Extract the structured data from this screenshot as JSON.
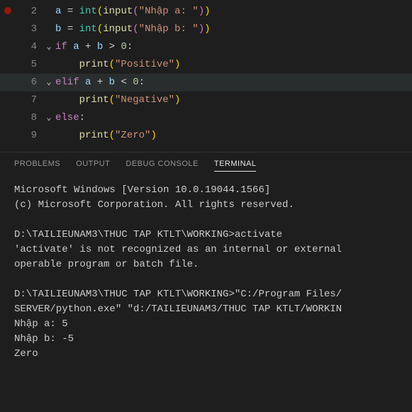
{
  "editor": {
    "lines": [
      {
        "num": "2",
        "fold": "",
        "highlight": false,
        "tokens": [
          {
            "t": "a",
            "c": "tok-var"
          },
          {
            "t": " ",
            "c": ""
          },
          {
            "t": "=",
            "c": "tok-op"
          },
          {
            "t": " ",
            "c": ""
          },
          {
            "t": "int",
            "c": "tok-builtin"
          },
          {
            "t": "(",
            "c": "tok-paren"
          },
          {
            "t": "input",
            "c": "tok-func"
          },
          {
            "t": "(",
            "c": "tok-paren2"
          },
          {
            "t": "\"Nhập a: \"",
            "c": "tok-str"
          },
          {
            "t": ")",
            "c": "tok-paren2"
          },
          {
            "t": ")",
            "c": "tok-paren"
          }
        ]
      },
      {
        "num": "3",
        "fold": "",
        "highlight": false,
        "tokens": [
          {
            "t": "b",
            "c": "tok-var"
          },
          {
            "t": " ",
            "c": ""
          },
          {
            "t": "=",
            "c": "tok-op"
          },
          {
            "t": " ",
            "c": ""
          },
          {
            "t": "int",
            "c": "tok-builtin"
          },
          {
            "t": "(",
            "c": "tok-paren"
          },
          {
            "t": "input",
            "c": "tok-func"
          },
          {
            "t": "(",
            "c": "tok-paren2"
          },
          {
            "t": "\"Nhập b: \"",
            "c": "tok-str"
          },
          {
            "t": ")",
            "c": "tok-paren2"
          },
          {
            "t": ")",
            "c": "tok-paren"
          }
        ]
      },
      {
        "num": "4",
        "fold": "⌄",
        "highlight": false,
        "tokens": [
          {
            "t": "if",
            "c": "tok-kw"
          },
          {
            "t": " ",
            "c": ""
          },
          {
            "t": "a",
            "c": "tok-var"
          },
          {
            "t": " ",
            "c": ""
          },
          {
            "t": "+",
            "c": "tok-op"
          },
          {
            "t": " ",
            "c": ""
          },
          {
            "t": "b",
            "c": "tok-var"
          },
          {
            "t": " ",
            "c": ""
          },
          {
            "t": ">",
            "c": "tok-op"
          },
          {
            "t": " ",
            "c": ""
          },
          {
            "t": "0",
            "c": "tok-num"
          },
          {
            "t": ":",
            "c": "tok-op"
          }
        ]
      },
      {
        "num": "5",
        "fold": "",
        "highlight": false,
        "indent": 1,
        "tokens": [
          {
            "t": "    ",
            "c": ""
          },
          {
            "t": "print",
            "c": "tok-func"
          },
          {
            "t": "(",
            "c": "tok-paren"
          },
          {
            "t": "\"Positive\"",
            "c": "tok-str"
          },
          {
            "t": ")",
            "c": "tok-paren"
          }
        ]
      },
      {
        "num": "6",
        "fold": "⌄",
        "highlight": true,
        "tokens": [
          {
            "t": "elif",
            "c": "tok-kw"
          },
          {
            "t": " ",
            "c": ""
          },
          {
            "t": "a",
            "c": "tok-var"
          },
          {
            "t": " ",
            "c": ""
          },
          {
            "t": "+",
            "c": "tok-op"
          },
          {
            "t": " ",
            "c": ""
          },
          {
            "t": "b",
            "c": "tok-var"
          },
          {
            "t": " ",
            "c": ""
          },
          {
            "t": "<",
            "c": "tok-op"
          },
          {
            "t": " ",
            "c": ""
          },
          {
            "t": "0",
            "c": "tok-num"
          },
          {
            "t": ":",
            "c": "tok-op"
          }
        ]
      },
      {
        "num": "7",
        "fold": "",
        "highlight": false,
        "indent": 1,
        "tokens": [
          {
            "t": "    ",
            "c": ""
          },
          {
            "t": "print",
            "c": "tok-func"
          },
          {
            "t": "(",
            "c": "tok-paren"
          },
          {
            "t": "\"Negative\"",
            "c": "tok-str"
          },
          {
            "t": ")",
            "c": "tok-paren"
          }
        ]
      },
      {
        "num": "8",
        "fold": "⌄",
        "highlight": false,
        "tokens": [
          {
            "t": "else",
            "c": "tok-kw"
          },
          {
            "t": ":",
            "c": "tok-op"
          }
        ]
      },
      {
        "num": "9",
        "fold": "",
        "highlight": false,
        "indent": 1,
        "tokens": [
          {
            "t": "    ",
            "c": ""
          },
          {
            "t": "print",
            "c": "tok-func"
          },
          {
            "t": "(",
            "c": "tok-paren"
          },
          {
            "t": "\"Zero\"",
            "c": "tok-str"
          },
          {
            "t": ")",
            "c": "tok-paren"
          }
        ]
      }
    ]
  },
  "panel": {
    "tabs": {
      "problems": "PROBLEMS",
      "output": "OUTPUT",
      "debug": "DEBUG CONSOLE",
      "terminal": "TERMINAL"
    },
    "terminal_lines": [
      "Microsoft Windows [Version 10.0.19044.1566]",
      "(c) Microsoft Corporation. All rights reserved.",
      "",
      "D:\\TAILIEUNAM3\\THUC TAP KTLT\\WORKING>activate",
      "'activate' is not recognized as an internal or external",
      "operable program or batch file.",
      "",
      "D:\\TAILIEUNAM3\\THUC TAP KTLT\\WORKING>\"C:/Program Files/",
      "SERVER/python.exe\" \"d:/TAILIEUNAM3/THUC TAP KTLT/WORKIN",
      "Nhập a: 5",
      "Nhập b: -5",
      "Zero"
    ]
  }
}
